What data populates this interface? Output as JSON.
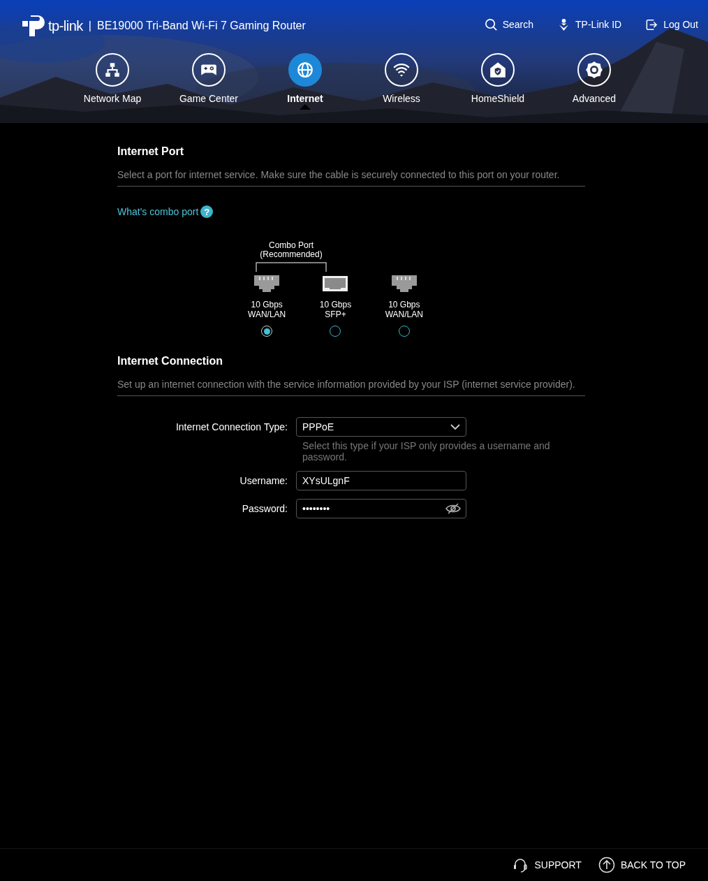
{
  "header": {
    "brand": "tp-link",
    "separator": "|",
    "model": "BE19000 Tri-Band Wi-Fi 7 Gaming Router",
    "links": [
      {
        "label": "Search"
      },
      {
        "label": "TP-Link ID"
      },
      {
        "label": "Log Out"
      }
    ],
    "nav": [
      {
        "label": "Network Map",
        "selected": false
      },
      {
        "label": "Game Center",
        "selected": false
      },
      {
        "label": "Internet",
        "selected": true
      },
      {
        "label": "Wireless",
        "selected": false
      },
      {
        "label": "HomeShield",
        "selected": false
      },
      {
        "label": "Advanced",
        "selected": false
      }
    ]
  },
  "internet_port": {
    "title": "Internet Port",
    "description": "Select a port for internet service. Make sure the cable is securely connected to this port on your router.",
    "help_link": "What's combo port",
    "help_icon": "?",
    "combo_label": [
      "Combo Port",
      "(Recommended)"
    ],
    "ports": [
      {
        "kind": "rj45",
        "label": [
          "10 Gbps",
          "WAN/LAN"
        ],
        "selected": true
      },
      {
        "kind": "sfp",
        "label": [
          "10 Gbps",
          "SFP+"
        ],
        "selected": false
      },
      {
        "kind": "rj45",
        "label": [
          "10 Gbps",
          "WAN/LAN"
        ],
        "selected": false
      }
    ]
  },
  "internet_connection": {
    "title": "Internet Connection",
    "description": "Set up an internet connection with the service information provided by your ISP (internet service provider).",
    "type_label": "Internet Connection Type:",
    "type_value": "PPPoE",
    "type_hint": "Select this type if your ISP only provides a username and password.",
    "username_label": "Username:",
    "username_value": "XYsULgnF",
    "password_label": "Password:",
    "password_value": "••••••••"
  },
  "footer": {
    "support": "SUPPORT",
    "back_to_top": "BACK TO TOP"
  }
}
